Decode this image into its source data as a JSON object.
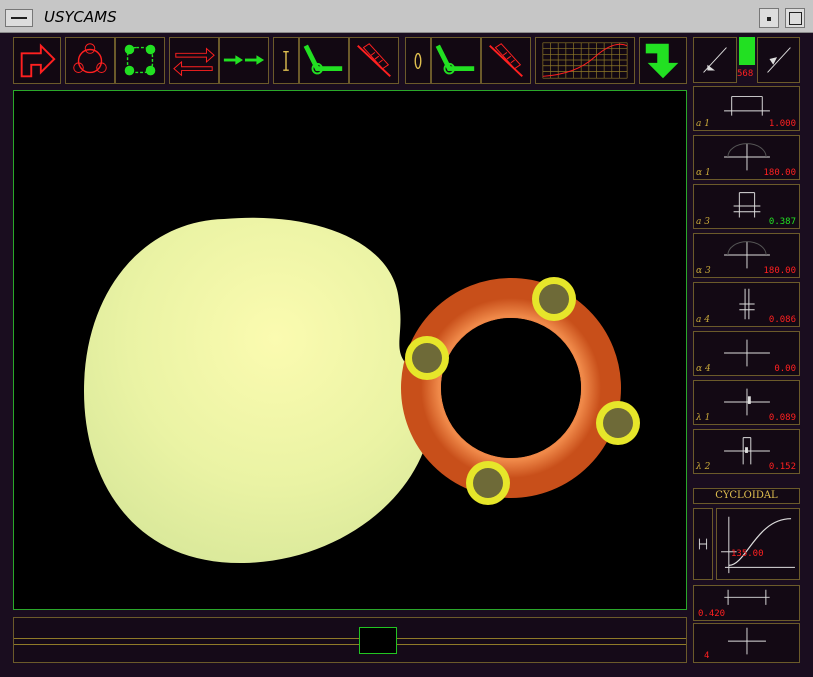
{
  "app": {
    "title": "USYCAMS"
  },
  "panels": [
    {
      "id": "a1",
      "label": "a 1",
      "value": "1.000",
      "color": "red"
    },
    {
      "id": "alpha1",
      "label": "α 1",
      "value": "180.00",
      "color": "red"
    },
    {
      "id": "a3",
      "label": "a 3",
      "value": "0.387",
      "color": "green"
    },
    {
      "id": "alpha3",
      "label": "α 3",
      "value": "180.00",
      "color": "red"
    },
    {
      "id": "a4",
      "label": "a 4",
      "value": "0.086",
      "color": "red"
    },
    {
      "id": "alpha4",
      "label": "α 4",
      "value": "0.00",
      "color": "red"
    },
    {
      "id": "lambda1",
      "label": "λ 1",
      "value": "0.089",
      "color": "red"
    },
    {
      "id": "lambda2",
      "label": "λ 2",
      "value": "0.152",
      "color": "red"
    }
  ],
  "motion_law": {
    "label": "CYCLOIDAL",
    "angle": "135.00"
  },
  "bottom_panels": {
    "stroke": "0.420",
    "count": "4"
  },
  "top_right": {
    "value": "568"
  },
  "colors": {
    "border": "#6b5a2a",
    "accent_green": "#22c422",
    "accent_red": "#ff2020",
    "cam": "#f0f5a8",
    "ring": "#e06a2a",
    "roller": "#e6e62a"
  },
  "icons": [
    "arrow-turn-icon",
    "three-rollers-icon",
    "four-rollers-icon",
    "translation-arrows-icon",
    "dashed-arrows-icon",
    "linear-follower-icon",
    "lever-arm-icon",
    "spring-mechanism-icon",
    "oscillating-follower-icon",
    "lever-arm-2-icon",
    "spring-mechanism-2-icon",
    "grid-graph-icon",
    "arrow-down-icon"
  ]
}
